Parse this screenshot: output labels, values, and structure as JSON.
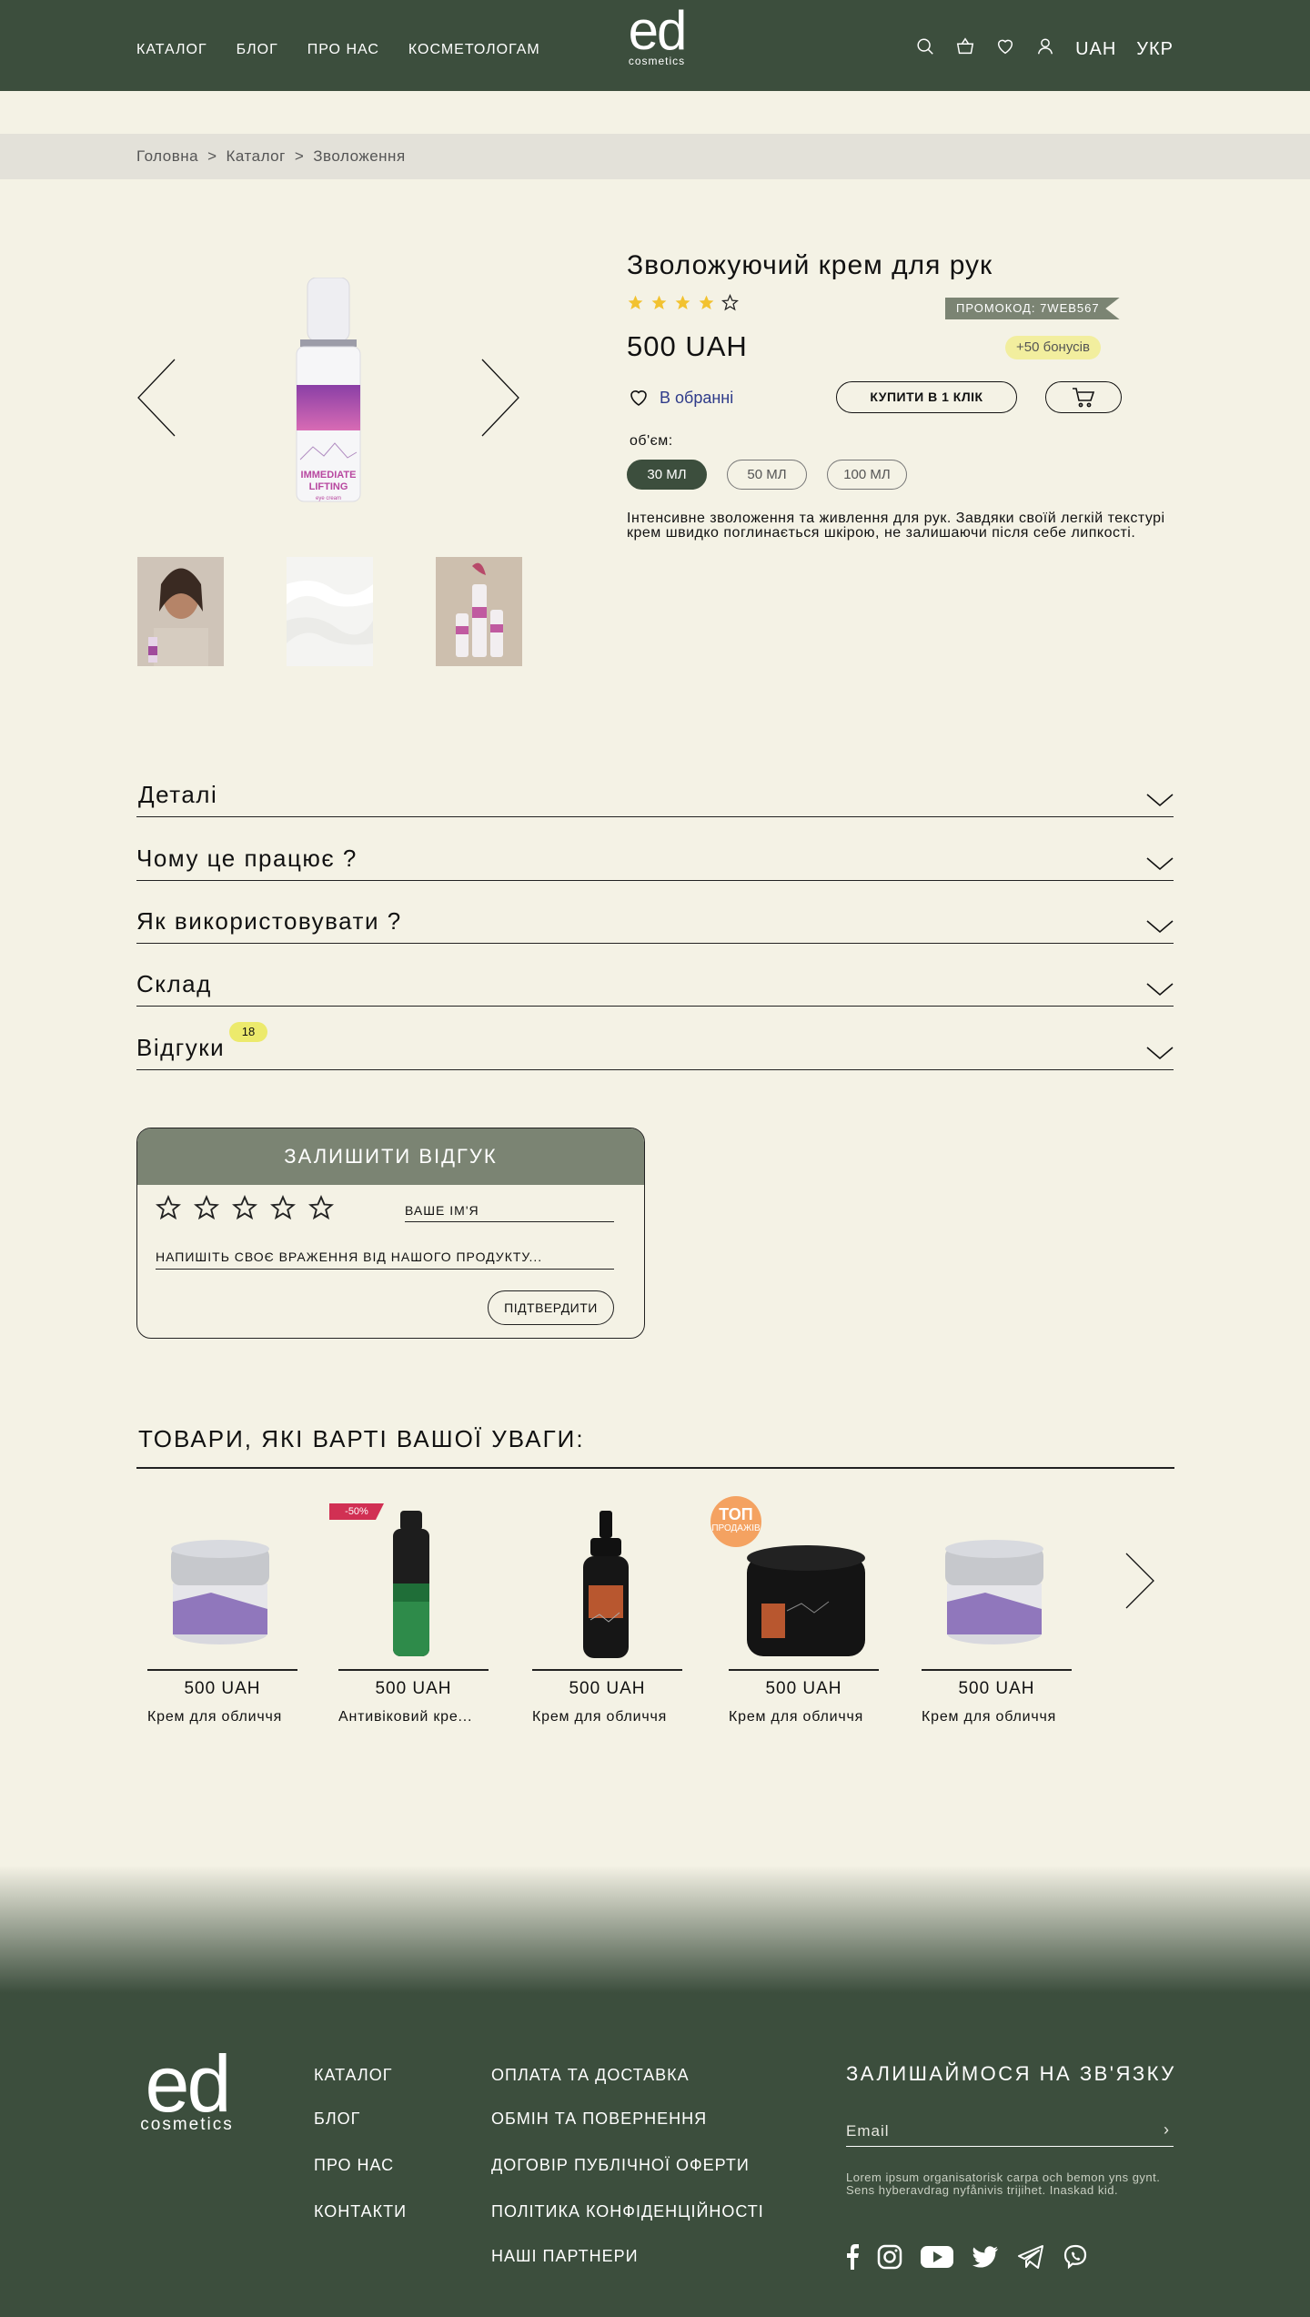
{
  "header": {
    "nav": [
      "КАТАЛОГ",
      "БЛОГ",
      "ПРО НАС",
      "КОСМЕТОЛОГАМ"
    ],
    "logo_main": "ed",
    "logo_sub": "cosmetics",
    "currency": "UAH",
    "language": "УКР",
    "icons": [
      "search-icon",
      "basket-icon",
      "heart-icon",
      "user-icon"
    ]
  },
  "breadcrumb": [
    "Головна",
    ">",
    "Каталог",
    ">",
    "Зволоження"
  ],
  "product": {
    "title": "Зволожуючий крем для рук",
    "rating": 4,
    "rating_max": 5,
    "promo": "ПРОМОКОД: 7WEB567",
    "price": "500 UAH",
    "bonus": "+50 бонусів",
    "favorite_label": "В обранні",
    "buy_one_click": "КУПИТИ В 1 КЛІК",
    "volume_label": "об'єм:",
    "volumes": [
      "30 МЛ",
      "50 МЛ",
      "100 МЛ"
    ],
    "selected_volume": "30 МЛ",
    "description": "Інтенсивне зволоження та живлення для рук. Завдяки своїй легкій текстурі крем швидко поглинається шкірою, не залишаючи після себе липкості.",
    "bottle_text_1": "IMMEDIATE",
    "bottle_text_2": "LIFTING",
    "bottle_text_3": "eye cream"
  },
  "accordions": [
    {
      "label": "Деталі"
    },
    {
      "label": "Чому це працює ?"
    },
    {
      "label": "Як використовувати ?"
    },
    {
      "label": "Склад"
    },
    {
      "label": "Відгуки",
      "badge": "18"
    }
  ],
  "review_form": {
    "title": "ЗАЛИШИТИ ВІДГУК",
    "name_placeholder": "ВАШЕ ІМ'Я",
    "message_placeholder": "НАПИШІТЬ СВОЄ ВРАЖЕННЯ ВІД НАШОГО ПРОДУКТУ...",
    "submit": "ПІДТВЕРДИТИ"
  },
  "recommendations": {
    "title": "ТОВАРИ, ЯКІ ВАРТІ ВАШОЇ УВАГИ:",
    "items": [
      {
        "price": "500 UAH",
        "name": "Крем для обличчя"
      },
      {
        "price": "500 UAH",
        "name": "Антивіковий кре...",
        "tag": "-50%"
      },
      {
        "price": "500 UAH",
        "name": "Крем для обличчя"
      },
      {
        "price": "500 UAH",
        "name": "Крем для обличчя",
        "badge_1": "ТОП",
        "badge_2": "ПРОДАЖІВ"
      },
      {
        "price": "500 UAH",
        "name": "Крем для обличчя"
      }
    ]
  },
  "footer": {
    "logo_main": "ed",
    "logo_sub": "cosmetics",
    "col1": [
      "КАТАЛОГ",
      "БЛОГ",
      "ПРО НАС",
      "КОНТАКТИ"
    ],
    "col2": [
      "ОПЛАТА ТА ДОСТАВКА",
      "ОБМІН ТА ПОВЕРНЕННЯ",
      "ДОГОВІР ПУБЛІЧНОЇ ОФЕРТИ",
      "ПОЛІТИКА КОНФІДЕНЦІЙНОСТІ",
      "НАШІ ПАРТНЕРИ"
    ],
    "contact_title": "ЗАЛИШАЙМОСЯ НА ЗВ'ЯЗКУ",
    "email_placeholder": "Email",
    "email_submit": "›",
    "note": "Lorem ipsum organisatorisk carpa och bemon yns gynt. Sens hyberavdrag nyfånivis trijihet. Inaskad kid.",
    "socials": [
      "facebook-icon",
      "instagram-icon",
      "youtube-icon",
      "twitter-icon",
      "telegram-icon",
      "viber-icon"
    ]
  },
  "colors": {
    "brand_dark": "#3c4e3d",
    "background": "#f4f2e5",
    "accent_grey": "#7b8473",
    "star": "#f2c230",
    "sale": "#d13053",
    "top": "#f4a261"
  }
}
